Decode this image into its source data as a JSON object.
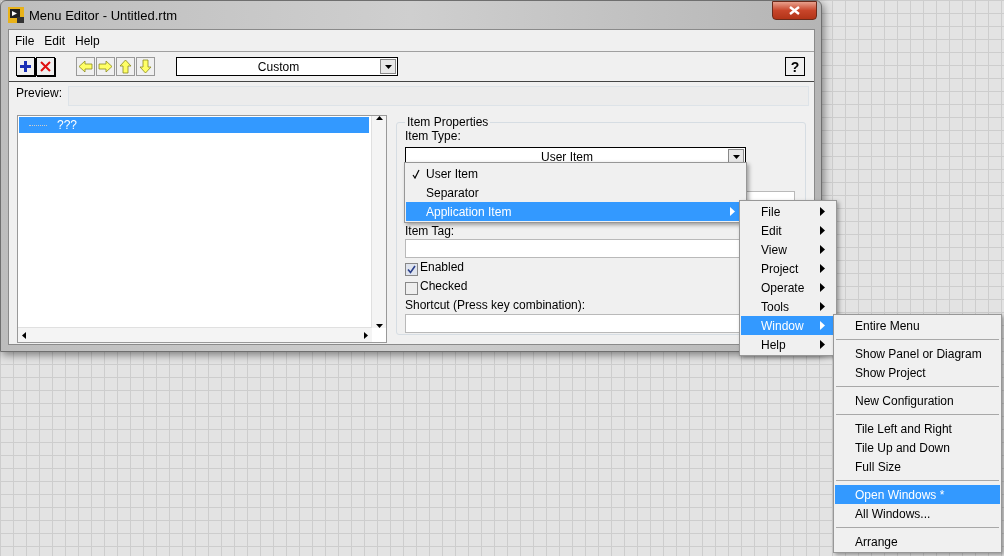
{
  "window": {
    "title": "Menu Editor - Untitled.rtm"
  },
  "menu_bar": [
    "File",
    "Edit",
    "Help"
  ],
  "toolbar": {
    "preset": "Custom",
    "help": "?"
  },
  "preview": {
    "label": "Preview:"
  },
  "menu_tree": [
    {
      "label": "???",
      "selected": true
    }
  ],
  "item_properties": {
    "title": "Item Properties",
    "item_type_label": "Item Type:",
    "item_type": "User Item",
    "item_tag_label": "Item Tag:",
    "checkboxes": [
      {
        "label": "Enabled",
        "checked": true
      },
      {
        "label": "Checked",
        "checked": false
      }
    ],
    "shortcut_label": "Shortcut (Press key combination):"
  },
  "item_type_menu": [
    {
      "label": "User Item",
      "checked": true,
      "selected": false,
      "submenu": false
    },
    {
      "label": "Separator",
      "checked": false,
      "selected": false,
      "submenu": false
    },
    {
      "label": "Application Item",
      "checked": false,
      "selected": true,
      "submenu": true
    }
  ],
  "application_menu": [
    {
      "label": "File",
      "selected": false
    },
    {
      "label": "Edit",
      "selected": false
    },
    {
      "label": "View",
      "selected": false
    },
    {
      "label": "Project",
      "selected": false
    },
    {
      "label": "Operate",
      "selected": false
    },
    {
      "label": "Tools",
      "selected": false
    },
    {
      "label": "Window",
      "selected": true
    },
    {
      "label": "Help",
      "selected": false
    }
  ],
  "window_menu": [
    {
      "kind": "item",
      "label": "Entire Menu",
      "selected": false
    },
    {
      "kind": "separator"
    },
    {
      "kind": "item",
      "label": "Show Panel or Diagram",
      "selected": false
    },
    {
      "kind": "item",
      "label": "Show Project",
      "selected": false
    },
    {
      "kind": "separator"
    },
    {
      "kind": "item",
      "label": "New Configuration",
      "selected": false
    },
    {
      "kind": "separator"
    },
    {
      "kind": "item",
      "label": "Tile Left and Right",
      "selected": false
    },
    {
      "kind": "item",
      "label": "Tile Up and Down",
      "selected": false
    },
    {
      "kind": "item",
      "label": "Full Size",
      "selected": false
    },
    {
      "kind": "separator"
    },
    {
      "kind": "item",
      "label": "Open Windows *",
      "selected": true
    },
    {
      "kind": "item",
      "label": "All Windows...",
      "selected": false
    },
    {
      "kind": "separator"
    },
    {
      "kind": "item",
      "label": "Arrange",
      "selected": false
    }
  ]
}
